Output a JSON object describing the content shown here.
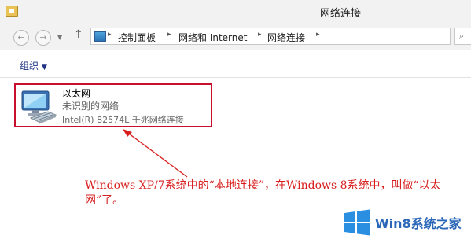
{
  "window": {
    "title": "网络连接"
  },
  "nav": {
    "back_icon": "back-arrow-icon",
    "forward_icon": "forward-arrow-icon",
    "up_icon": "up-arrow-icon"
  },
  "address": {
    "breadcrumbs": [
      "控制面板",
      "网络和 Internet",
      "网络连接"
    ]
  },
  "toolbar": {
    "organize_label": "组织"
  },
  "connection": {
    "name": "以太网",
    "status": "未识别的网络",
    "device": "Intel(R) 82574L 千兆网络连接"
  },
  "annotation": {
    "text": "Windows XP/7系统中的“本地连接”，在Windows 8系统中，叫做“以太网”了。",
    "color": "#d81e1e"
  },
  "watermark": {
    "text": "Win8系统之家",
    "brand_color": "#2a67b8"
  }
}
